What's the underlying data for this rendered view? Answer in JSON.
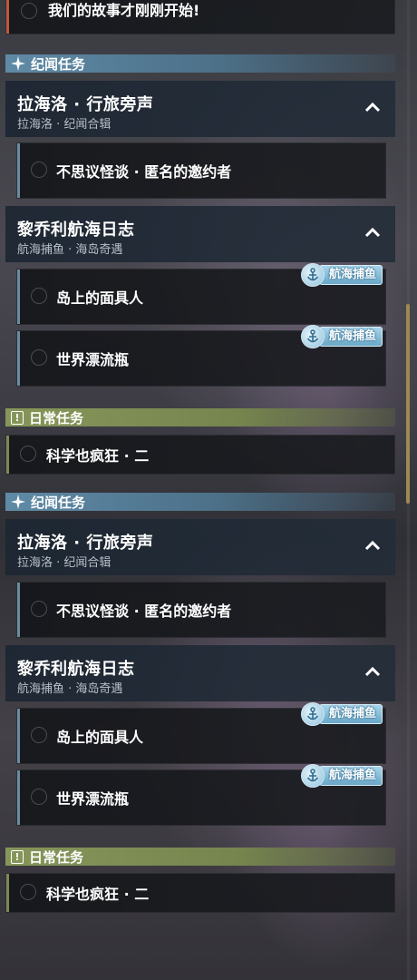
{
  "colors": {
    "lore_accent": "#5f8aa6",
    "daily_accent": "#86965a",
    "badge_blue": "#8ec2dc",
    "scroll_thumb": "#9c8a52"
  },
  "top_partial_quest": {
    "label": "我们的故事才刚刚开始!"
  },
  "blocks": [
    {
      "lore_header": "纪闻任务",
      "chain1": {
        "title": "拉海洛 · 行旅旁声",
        "subtitle": "拉海洛 · 纪闻合辑",
        "quest": "不思议怪谈 · 匿名的邀约者"
      },
      "chain2": {
        "title": "黎乔利航海日志",
        "subtitle": "航海捕鱼 · 海岛奇遇",
        "quest1": "岛上的面具人",
        "quest2": "世界漂流瓶",
        "badge": "航海捕鱼"
      },
      "daily_header": "日常任务",
      "daily_quest": "科学也疯狂 · 二"
    },
    {
      "lore_header": "纪闻任务",
      "chain1": {
        "title": "拉海洛 · 行旅旁声",
        "subtitle": "拉海洛 · 纪闻合辑",
        "quest": "不思议怪谈 · 匿名的邀约者"
      },
      "chain2": {
        "title": "黎乔利航海日志",
        "subtitle": "航海捕鱼 · 海岛奇遇",
        "quest1": "岛上的面具人",
        "quest2": "世界漂流瓶",
        "badge": "航海捕鱼"
      },
      "daily_header": "日常任务",
      "daily_quest": "科学也疯狂 · 二"
    }
  ]
}
